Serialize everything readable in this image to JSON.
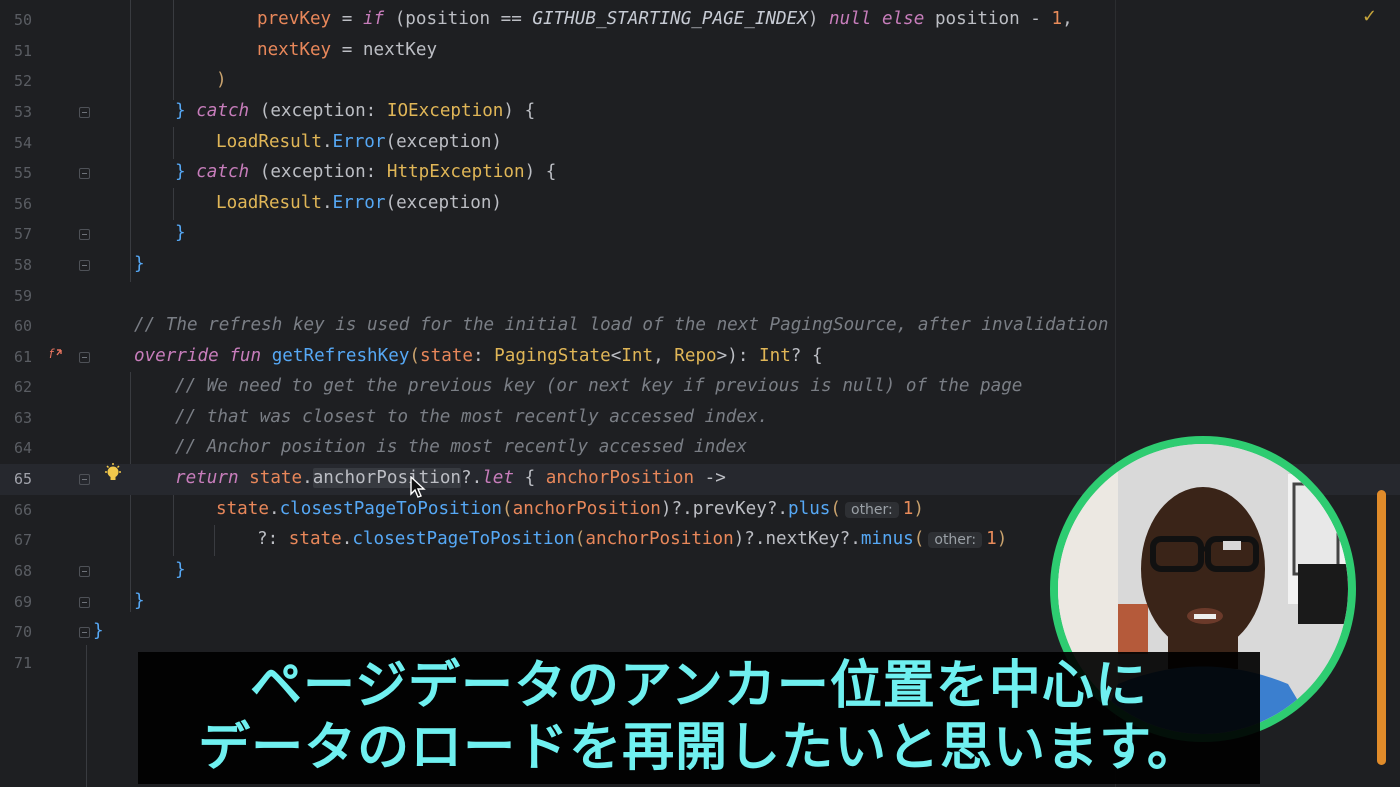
{
  "editor": {
    "lines": [
      {
        "n": "50"
      },
      {
        "n": "51"
      },
      {
        "n": "52"
      },
      {
        "n": "53"
      },
      {
        "n": "54"
      },
      {
        "n": "55"
      },
      {
        "n": "56"
      },
      {
        "n": "57"
      },
      {
        "n": "58"
      },
      {
        "n": "59"
      },
      {
        "n": "60"
      },
      {
        "n": "61"
      },
      {
        "n": "62"
      },
      {
        "n": "63"
      },
      {
        "n": "64"
      },
      {
        "n": "65"
      },
      {
        "n": "66"
      },
      {
        "n": "67"
      },
      {
        "n": "68"
      },
      {
        "n": "69"
      },
      {
        "n": "70"
      },
      {
        "n": "71"
      }
    ],
    "code": {
      "l50": {
        "a": "prevKey",
        "b": " = ",
        "c": "if",
        "d": " (position == ",
        "e": "GITHUB_STARTING_PAGE_INDEX",
        "f": ") ",
        "g": "null",
        "h": " ",
        "i": "else",
        "j": " position - ",
        "k": "1",
        "l": ","
      },
      "l51": {
        "a": "nextKey",
        "b": " = nextKey"
      },
      "l52": {
        "a": ")"
      },
      "l53": {
        "a": "} ",
        "b": "catch",
        "c": " (exception: ",
        "d": "IOException",
        "e": ") {"
      },
      "l54": {
        "a": "LoadResult",
        "b": ".",
        "c": "Error",
        "d": "(exception)"
      },
      "l55": {
        "a": "} ",
        "b": "catch",
        "c": " (exception: ",
        "d": "HttpException",
        "e": ") {"
      },
      "l56": {
        "a": "LoadResult",
        "b": ".",
        "c": "Error",
        "d": "(exception)"
      },
      "l57": {
        "a": "}"
      },
      "l58": {
        "a": "}"
      },
      "l60": {
        "a": "// The refresh key is used for the initial load of the next PagingSource, after invalidation"
      },
      "l61": {
        "a": "override",
        "b": " ",
        "c": "fun",
        "d": " ",
        "e": "getRefreshKey",
        "f": "(",
        "g": "state",
        "h": ": ",
        "i": "PagingState",
        "j": "<",
        "k": "Int",
        "l": ", ",
        "m": "Repo",
        "n": ">): ",
        "o": "Int",
        "p": "? {"
      },
      "l62": {
        "a": "// We need to get the previous key (or next key if previous is null) of the page"
      },
      "l63": {
        "a": "// that was closest to the most recently accessed index."
      },
      "l64": {
        "a": "// Anchor position is the most recently accessed index"
      },
      "l65": {
        "a": "return",
        "b": " ",
        "c": "state",
        "d": ".",
        "e": "anchorPosition",
        "f": "?.",
        "g": "let",
        "h": " { ",
        "i": "anchorPosition",
        "j": " ->"
      },
      "l66": {
        "a": "state",
        "b": ".",
        "c": "closestPageToPosition",
        "d": "(",
        "e": "anchorPosition",
        "f": ")?.",
        "g": "prevKey",
        "h": "?.",
        "i": "plus",
        "j": "(",
        "hint": "other:",
        "k": "1",
        "l": ")"
      },
      "l67": {
        "a": "?: ",
        "b": "state",
        "c": ".",
        "d": "closestPageToPosition",
        "e": "(",
        "f": "anchorPosition",
        "g": ")?.",
        "h": "nextKey",
        "i": "?.",
        "j": "minus",
        "k": "(",
        "hint": "other:",
        "m": "1",
        "n": ")"
      },
      "l68": {
        "a": "}"
      },
      "l69": {
        "a": "}"
      },
      "l70": {
        "a": "}"
      }
    }
  },
  "icons": {
    "check": "checkmark-icon",
    "override": "override-gutter-icon",
    "bulb": "lightbulb-icon"
  },
  "subtitle": {
    "line1": "ページデータのアンカー位置を中心に",
    "line2": "データのロードを再開したいと思います。"
  },
  "colors": {
    "background": "#1e1f22",
    "webcam_border": "#2ecc71",
    "subtitle": "#6ff0f0",
    "scrollbar": "#e08b2a"
  }
}
